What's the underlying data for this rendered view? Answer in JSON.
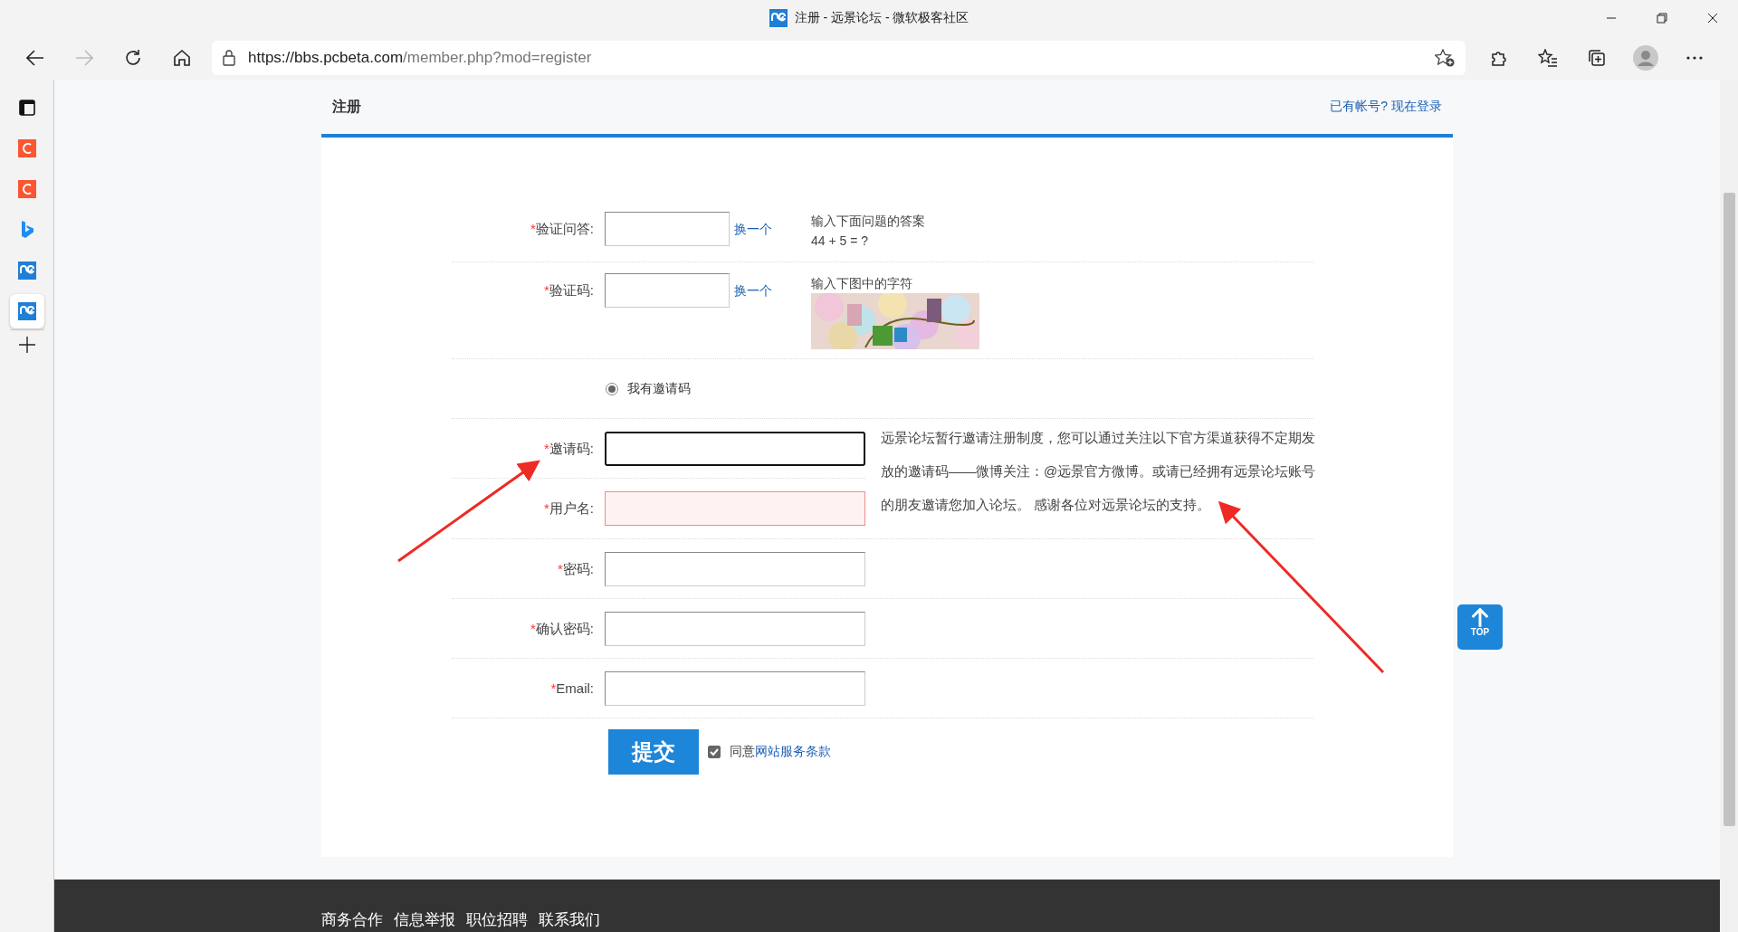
{
  "window": {
    "title": "注册 - 远景论坛 - 微软极客社区"
  },
  "address_bar": {
    "url_host": "https://bbs.pcbeta.com",
    "url_path": "/member.php?mod=register"
  },
  "sidebar": {
    "items": [
      {
        "kind": "tabs",
        "selected": false
      },
      {
        "kind": "c",
        "selected": false
      },
      {
        "kind": "c",
        "selected": false
      },
      {
        "kind": "bing",
        "selected": false
      },
      {
        "kind": "pc",
        "selected": false
      },
      {
        "kind": "pc",
        "selected": true
      }
    ]
  },
  "header": {
    "title": "注册",
    "login_link": "已有帐号? 现在登录"
  },
  "form": {
    "rows": [
      {
        "kind": "qa",
        "required": "*",
        "label": "验证问答:",
        "action": "换一个",
        "hint": "输入下面问题的答案",
        "question": "44 + 5 = ?"
      },
      {
        "kind": "captcha",
        "required": "*",
        "label": "验证码:",
        "action": "换一个",
        "hint": "输入下图中的字符"
      },
      {
        "kind": "radio",
        "label": "我有邀请码",
        "selected": true
      },
      {
        "kind": "invite",
        "required": "*",
        "label": "邀请码:",
        "focused": true
      },
      {
        "kind": "error",
        "required": "*",
        "label": "用户名:"
      },
      {
        "kind": "text",
        "required": "*",
        "label": "密码:"
      },
      {
        "kind": "text",
        "required": "*",
        "label": "确认密码:"
      },
      {
        "kind": "text",
        "required": "*",
        "label": "Email:"
      }
    ],
    "invite_note": "远景论坛暂行邀请注册制度，您可以通过关注以下官方渠道获得不定期发放的邀请码——微博关注：@远景官方微博。或请已经拥有远景论坛账号的朋友邀请您加入论坛。 感谢各位对远景论坛的支持。",
    "submit": "提交",
    "agree": {
      "checked": true,
      "prefix": "同意",
      "link": "网站服务条款"
    }
  },
  "back_to_top": "TOP",
  "footer": {
    "links": [
      "商务合作",
      "信息举报",
      "职位招聘",
      "联系我们"
    ]
  }
}
